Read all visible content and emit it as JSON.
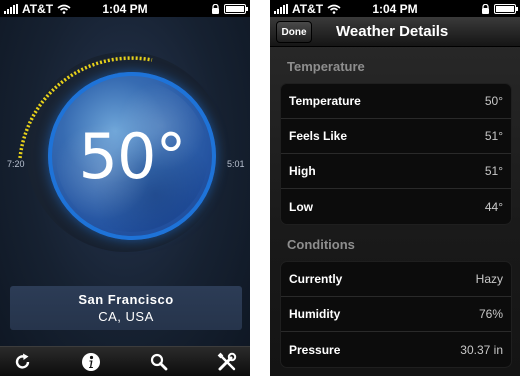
{
  "left": {
    "status": {
      "carrier": "AT&T",
      "time": "1:04 PM"
    },
    "temperature": "50°",
    "sunrise": "7:20",
    "sunset": "5:01",
    "city": "San Francisco",
    "region": "CA, USA",
    "tabs": [
      {
        "icon": "refresh-icon"
      },
      {
        "icon": "info-icon"
      },
      {
        "icon": "search-icon"
      },
      {
        "icon": "tools-icon"
      }
    ],
    "colors": {
      "dial": "#1e73d8",
      "arc": "#e8d21a"
    }
  },
  "right": {
    "status": {
      "carrier": "AT&T",
      "time": "1:04 PM"
    },
    "done_label": "Done",
    "title": "Weather Details",
    "sections": [
      {
        "header": "Temperature",
        "rows": [
          {
            "label": "Temperature",
            "value": "50°"
          },
          {
            "label": "Feels Like",
            "value": "51°"
          },
          {
            "label": "High",
            "value": "51°"
          },
          {
            "label": "Low",
            "value": "44°"
          }
        ]
      },
      {
        "header": "Conditions",
        "rows": [
          {
            "label": "Currently",
            "value": "Hazy"
          },
          {
            "label": "Humidity",
            "value": "76%"
          },
          {
            "label": "Pressure",
            "value": "30.37 in"
          }
        ]
      }
    ]
  }
}
